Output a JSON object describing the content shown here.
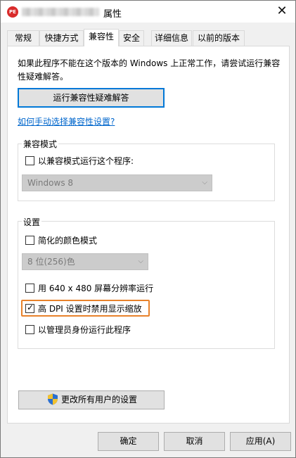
{
  "window": {
    "title_suffix": "属性",
    "app_icon_text": "PE",
    "close_glyph": "✕"
  },
  "tabs": [
    {
      "label": "常规"
    },
    {
      "label": "快捷方式"
    },
    {
      "label": "兼容性"
    },
    {
      "label": "安全"
    },
    {
      "label": "详细信息"
    },
    {
      "label": "以前的版本"
    }
  ],
  "compat": {
    "description": "如果此程序不能在这个版本的 Windows 上正常工作，请尝试运行兼容性疑难解答。",
    "troubleshoot_button": "运行兼容性疑难解答",
    "manual_link": "如何手动选择兼容性设置?"
  },
  "compat_mode": {
    "group_label": "兼容模式",
    "checkbox_label": "以兼容模式运行这个程序:",
    "checked": false,
    "select_value": "Windows 8"
  },
  "settings": {
    "group_label": "设置",
    "reduced_color": {
      "label": "简化的颜色模式",
      "checked": false
    },
    "color_select": "8 位(256)色",
    "res_640": {
      "label": "用 640 x 480 屏幕分辨率运行",
      "checked": false
    },
    "high_dpi": {
      "label": "高 DPI 设置时禁用显示缩放",
      "checked": true
    },
    "run_admin": {
      "label": "以管理员身份运行此程序",
      "checked": false
    }
  },
  "change_all_button": "更改所有用户的设置",
  "icons": {
    "shield": "uac-shield-icon",
    "check": "✓",
    "dropdown": "⌵"
  },
  "footer": {
    "ok": "确定",
    "cancel": "取消",
    "apply": "应用(A)"
  },
  "colors": {
    "accent": "#0078d7",
    "link": "#0066cc",
    "highlight_annotation": "#e8822b"
  }
}
